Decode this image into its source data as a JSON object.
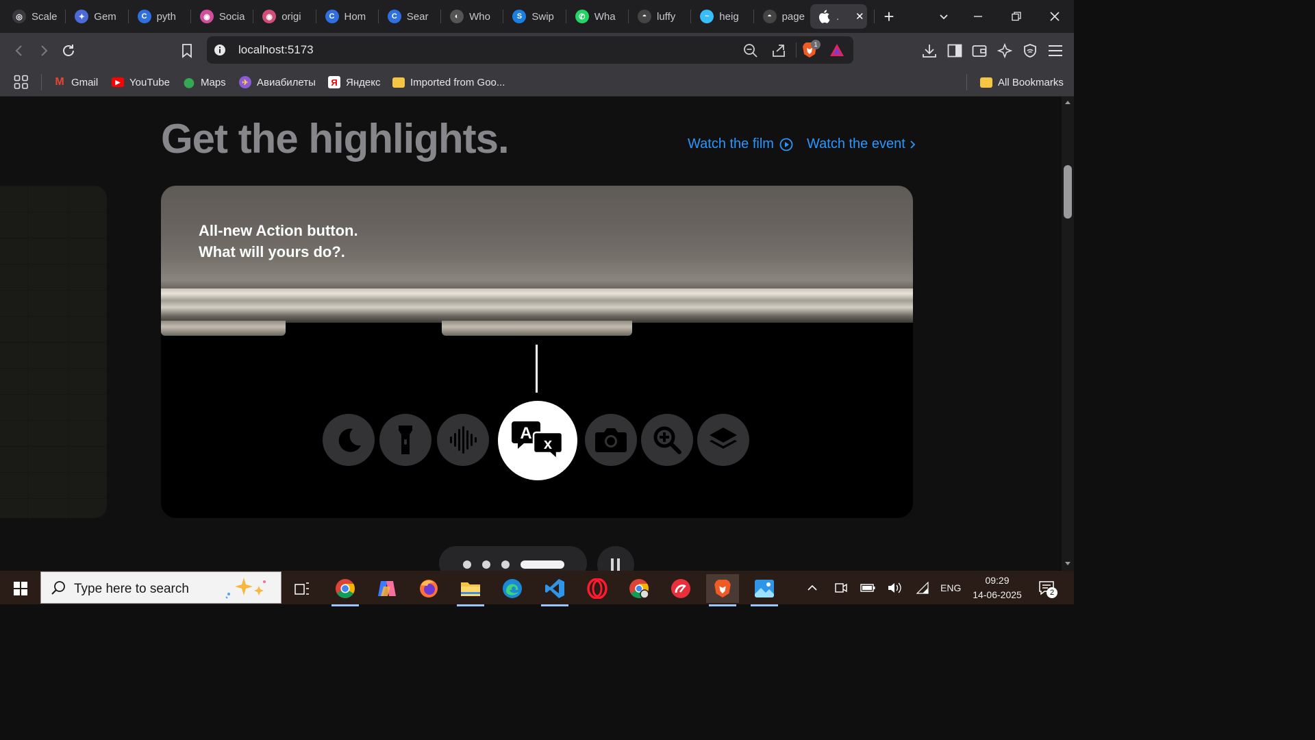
{
  "browser": {
    "tabs": [
      {
        "title": "Scale",
        "color": "#3a3a3e",
        "glyph": "◎"
      },
      {
        "title": "Gem",
        "color": "#4b6bd6",
        "glyph": "✦"
      },
      {
        "title": "pyth",
        "color": "#2f6fe0",
        "glyph": "C"
      },
      {
        "title": "Socia",
        "color": "#d24e9a",
        "glyph": "◉"
      },
      {
        "title": "origi",
        "color": "#d24e7a",
        "glyph": "◉"
      },
      {
        "title": "Hom",
        "color": "#2f6fe0",
        "glyph": "C"
      },
      {
        "title": "Sear",
        "color": "#2f6fe0",
        "glyph": "C"
      },
      {
        "title": "Who",
        "color": "#555",
        "glyph": "◐"
      },
      {
        "title": "Swip",
        "color": "#1b7ee0",
        "glyph": "S"
      },
      {
        "title": "Wha",
        "color": "#25d366",
        "glyph": "✆"
      },
      {
        "title": "luffy",
        "color": "#444",
        "glyph": "◓"
      },
      {
        "title": "heig",
        "color": "#38bdf8",
        "glyph": "~"
      },
      {
        "title": "page",
        "color": "#444",
        "glyph": "◓"
      },
      {
        "title": ".",
        "color": "#3a3a3e",
        "glyph": ""
      }
    ],
    "url": "localhost:5173",
    "shield_count": "1"
  },
  "bookmarks": {
    "items": [
      {
        "label": "Gmail",
        "color": "#ea4335",
        "glyph": "M"
      },
      {
        "label": "YouTube",
        "color": "#ff0000",
        "glyph": "▶"
      },
      {
        "label": "Maps",
        "color": "#34a853",
        "glyph": "⬤"
      },
      {
        "label": "Авиабилеты",
        "color": "#8e5bd6",
        "glyph": "✈"
      },
      {
        "label": "Яндекс",
        "color": "#ffffff",
        "glyph": "Я"
      },
      {
        "label": "Imported from Goo...",
        "color": "#f6c544",
        "glyph": ""
      }
    ],
    "all_label": "All Bookmarks"
  },
  "page": {
    "headline": "Get the highlights.",
    "watch_film": "Watch the film",
    "watch_event": "Watch the event",
    "card_line1": "All-new Action button.",
    "card_line2": "What will yours do?.",
    "action_icons": [
      "moon-icon",
      "flashlight-icon",
      "voice-memo-icon",
      "translate-icon",
      "camera-icon",
      "magnifier-icon",
      "focus-layers-icon"
    ],
    "selected_action": "translate-icon",
    "carousel_pages": 4,
    "carousel_active_index": 3
  },
  "taskbar": {
    "search_placeholder": "Type here to search",
    "language": "ENG",
    "time": "09:29",
    "date": "14-06-2025",
    "notification_count": "2"
  }
}
